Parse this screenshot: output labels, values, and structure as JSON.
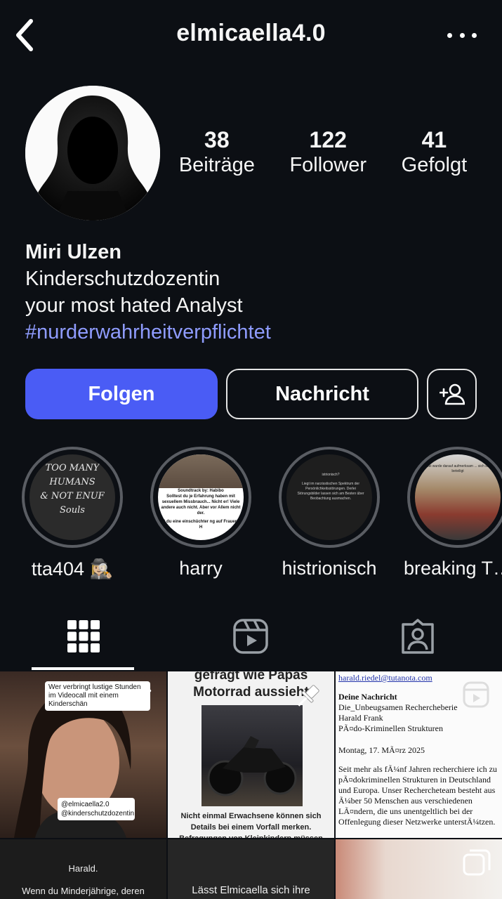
{
  "header": {
    "username": "elmicaella4.0"
  },
  "stats": [
    {
      "num": "38",
      "label": "Beiträge"
    },
    {
      "num": "122",
      "label": "Follower"
    },
    {
      "num": "41",
      "label": "Gefolgt"
    }
  ],
  "bio": {
    "name": "Miri Ulzen",
    "line1": "Kinderschutzdozentin",
    "line2": "your most hated Analyst",
    "hashtag": "#nurderwahrheitverpflichtet"
  },
  "actions": {
    "follow": "Folgen",
    "message": "Nachricht"
  },
  "highlights": [
    {
      "label": "tta404 🕵🏼‍♀️",
      "text1": "TOO MANY",
      "text2": "HUMANS",
      "text3": "& NOT ENUF",
      "text4": "Souls"
    },
    {
      "label": "harry",
      "text1": "Soundtrack by: Habibo",
      "text2": "Solltest du je Erfahrung haben mit sexuellem Missbrauch... Nicht er! Viele andere auch nicht. Aber vor Allem nicht der.",
      "text3": "st du eine einschüchter ng auf Frauen? H"
    },
    {
      "label": "histrionisch",
      "text1": "istrionisch?",
      "text2": "Liegt im narzisstischen Spektrum der Persönlichkeitsstörungen. Derlei Störungsbilder lassen sich am Besten über Beobachtung ausmachen."
    },
    {
      "label": "breaking T…",
      "text1": "Polizei wurde darauf aufmerksam ... sich selbst beteiligt"
    }
  ],
  "grid": {
    "cell1": {
      "text1": "Wer verbringt lustige Stunden im Videocall mit einem Kinderschän",
      "text2": "@elmicaella2.0",
      "text3": "@kinderschutzdozentin"
    },
    "cell2": {
      "title": "gefragt wie Papas Motorrad aussieht",
      "caption": "Nicht einmal Erwachsene können sich Details bei einem Vorfall merken. Befragungen von Kleinkindern müssen"
    },
    "cell3": {
      "email": "harald.riedel@tutanota.com",
      "heading": "Deine Nachricht",
      "line1": "Die_Unbeugsamen Recherche­berie",
      "line2": "Harald Frank",
      "line3": "PÃ¤do-Kriminellen Strukturen",
      "date": "Montag, 17. MÃ¤rz 2025",
      "body": "Seit mehr als fÃ¼nf Jahren recherchiere ich zu pÃ¤dokriminellen Strukturen in Deutschland und Europa. Unser Rechercheteam besteht aus Ã¼ber 50 Menschen aus verschiedenen LÃ¤ndern, die uns unentgeltlich bei der Offenlegung dieser Netzwerke unterstÃ¼tzen."
    },
    "cell4": {
      "line1": "Harald.",
      "line2": "Wenn du Minderjährige, deren"
    },
    "cell5": {
      "line1": "Lässt Elmicaella sich ihre"
    }
  },
  "colors": {
    "background": "#0c0f14",
    "accent": "#4a5cf5",
    "hashtag": "#8f9cff"
  }
}
